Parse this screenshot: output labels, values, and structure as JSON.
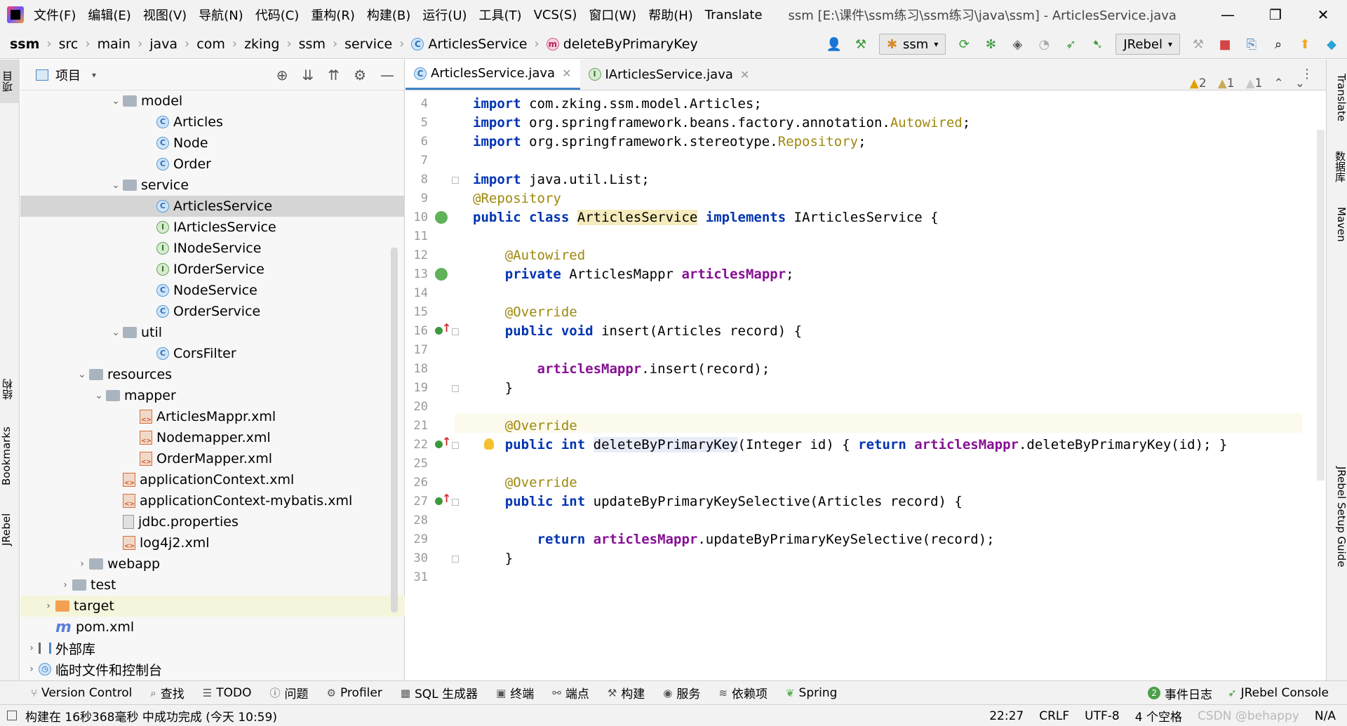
{
  "menubar": {
    "items": [
      "文件(F)",
      "编辑(E)",
      "视图(V)",
      "导航(N)",
      "代码(C)",
      "重构(R)",
      "构建(B)",
      "运行(U)",
      "工具(T)",
      "VCS(S)",
      "窗口(W)",
      "帮助(H)",
      "Translate"
    ],
    "window_title": "ssm [E:\\课件\\ssm练习\\ssm练习\\java\\ssm] - ArticlesService.java",
    "controls": [
      "—",
      "❐",
      "✕"
    ]
  },
  "navbar": {
    "breadcrumbs": [
      "ssm",
      "src",
      "main",
      "java",
      "com",
      "zking",
      "ssm",
      "service",
      "ArticlesService",
      "deleteByPrimaryKey"
    ],
    "run_config": "ssm",
    "jrebel": "JRebel"
  },
  "left_strip": {
    "tabs": [
      "项目",
      "结构",
      "Bookmarks",
      "JRebel"
    ]
  },
  "right_strip": {
    "tabs": [
      "Translate",
      "数据库",
      "Maven",
      "JRebel Setup Guide"
    ]
  },
  "project": {
    "title": "项目",
    "tree": [
      {
        "label": "model",
        "type": "folder",
        "depth": 5,
        "expanded": true
      },
      {
        "label": "Articles",
        "type": "class",
        "depth": 7
      },
      {
        "label": "Node",
        "type": "class",
        "depth": 7
      },
      {
        "label": "Order",
        "type": "class",
        "depth": 7
      },
      {
        "label": "service",
        "type": "folder",
        "depth": 5,
        "expanded": true
      },
      {
        "label": "ArticlesService",
        "type": "class",
        "depth": 7,
        "selected": true
      },
      {
        "label": "IArticlesService",
        "type": "interface",
        "depth": 7
      },
      {
        "label": "INodeService",
        "type": "interface",
        "depth": 7
      },
      {
        "label": "IOrderService",
        "type": "interface",
        "depth": 7
      },
      {
        "label": "NodeService",
        "type": "class",
        "depth": 7
      },
      {
        "label": "OrderService",
        "type": "class",
        "depth": 7
      },
      {
        "label": "util",
        "type": "folder",
        "depth": 5,
        "expanded": true
      },
      {
        "label": "CorsFilter",
        "type": "class",
        "depth": 7
      },
      {
        "label": "resources",
        "type": "folder",
        "depth": 3,
        "expanded": true
      },
      {
        "label": "mapper",
        "type": "folder",
        "depth": 4,
        "expanded": true
      },
      {
        "label": "ArticlesMappr.xml",
        "type": "xml",
        "depth": 6
      },
      {
        "label": "Nodemapper.xml",
        "type": "xml",
        "depth": 6
      },
      {
        "label": "OrderMapper.xml",
        "type": "xml",
        "depth": 6
      },
      {
        "label": "applicationContext.xml",
        "type": "xml",
        "depth": 5
      },
      {
        "label": "applicationContext-mybatis.xml",
        "type": "xml",
        "depth": 5
      },
      {
        "label": "jdbc.properties",
        "type": "props",
        "depth": 5
      },
      {
        "label": "log4j2.xml",
        "type": "xml",
        "depth": 5
      },
      {
        "label": "webapp",
        "type": "folder",
        "depth": 3,
        "expanded": false
      },
      {
        "label": "test",
        "type": "folder",
        "depth": 2,
        "expanded": false
      },
      {
        "label": "target",
        "type": "folder-orange",
        "depth": 1,
        "expanded": false,
        "highlight": true
      },
      {
        "label": "pom.xml",
        "type": "maven",
        "depth": 1
      },
      {
        "label": "外部库",
        "type": "lib",
        "depth": 0,
        "expanded": false
      },
      {
        "label": "临时文件和控制台",
        "type": "scratch",
        "depth": 0,
        "expanded": false
      }
    ]
  },
  "editor": {
    "tabs": [
      {
        "label": "ArticlesService.java",
        "active": true
      },
      {
        "label": "IArticlesService.java",
        "active": false
      }
    ],
    "inspections": {
      "warnings": "2",
      "weak_warnings": "1",
      "typos": "1"
    },
    "lines": [
      {
        "num": "4",
        "text": "import com.zking.ssm.model.Articles;"
      },
      {
        "num": "5",
        "text": "import org.springframework.beans.factory.annotation.Autowired;"
      },
      {
        "num": "6",
        "text": "import org.springframework.stereotype.Repository;"
      },
      {
        "num": "7",
        "text": ""
      },
      {
        "num": "8",
        "text": "import java.util.List;"
      },
      {
        "num": "9",
        "text": "@Repository"
      },
      {
        "num": "10",
        "text": "public class ArticlesService implements IArticlesService {"
      },
      {
        "num": "11",
        "text": ""
      },
      {
        "num": "12",
        "text": "    @Autowired"
      },
      {
        "num": "13",
        "text": "    private ArticlesMappr articlesMappr;"
      },
      {
        "num": "14",
        "text": ""
      },
      {
        "num": "15",
        "text": "    @Override"
      },
      {
        "num": "16",
        "text": "    public void insert(Articles record) {"
      },
      {
        "num": "17",
        "text": ""
      },
      {
        "num": "18",
        "text": "        articlesMappr.insert(record);"
      },
      {
        "num": "19",
        "text": "    }"
      },
      {
        "num": "20",
        "text": ""
      },
      {
        "num": "21",
        "text": "    @Override"
      },
      {
        "num": "22",
        "text": "    public int deleteByPrimaryKey(Integer id) { return articlesMappr.deleteByPrimaryKey(id); }"
      },
      {
        "num": "25",
        "text": ""
      },
      {
        "num": "26",
        "text": "    @Override"
      },
      {
        "num": "27",
        "text": "    public int updateByPrimaryKeySelective(Articles record) {"
      },
      {
        "num": "28",
        "text": ""
      },
      {
        "num": "29",
        "text": "        return articlesMappr.updateByPrimaryKeySelective(record);"
      },
      {
        "num": "30",
        "text": "    }"
      },
      {
        "num": "31",
        "text": ""
      }
    ]
  },
  "toolwindows": {
    "items": [
      "Version Control",
      "查找",
      "TODO",
      "问题",
      "Profiler",
      "SQL 生成器",
      "终端",
      "端点",
      "构建",
      "服务",
      "依赖项",
      "Spring"
    ],
    "event_log_count": "2",
    "event_log": "事件日志",
    "jrebel_console": "JRebel Console"
  },
  "statusbar": {
    "message": "构建在 16秒368毫秒 中成功完成 (今天 10:59)",
    "position": "22:27",
    "line_sep": "CRLF",
    "encoding": "UTF-8",
    "indent": "4 个空格",
    "watermark": "CSDN @behappy",
    "readonly": "N/A"
  },
  "colors": {
    "keyword": "#0033b3",
    "annotation": "#9e880d",
    "field": "#871094",
    "selection": "#d5d5d5",
    "tab_underline": "#4083c9"
  }
}
